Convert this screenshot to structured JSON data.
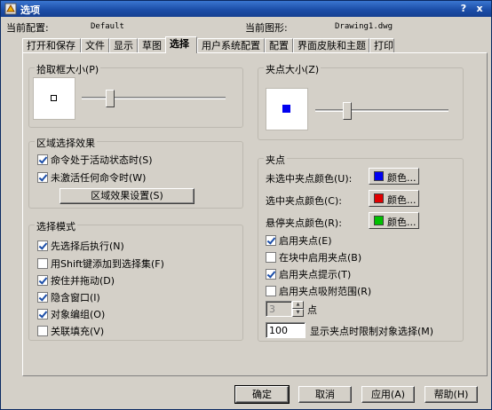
{
  "window": {
    "title": "选项",
    "help": "?",
    "close": "x"
  },
  "info": {
    "config_label": "当前配置:",
    "config_value": "Default",
    "drawing_label": "当前图形:",
    "drawing_value": "Drawing1.dwg"
  },
  "tabs": [
    "打开和保存",
    "文件",
    "显示",
    "草图",
    "选择",
    "用户系统配置",
    "配置",
    "界面皮肤和主题",
    "打印"
  ],
  "active_tab": "选择",
  "pickbox": {
    "title": "拾取框大小(P)",
    "slider_level": 0.18
  },
  "area_effect": {
    "title": "区域选择效果",
    "opt1": "命令处于活动状态时(S)",
    "opt2": "未激活任何命令时(W)",
    "button": "区域效果设置(S)"
  },
  "selection_mode": {
    "title": "选择模式",
    "items": [
      {
        "label": "先选择后执行(N)",
        "checked": true
      },
      {
        "label": "用Shift键添加到选择集(F)",
        "checked": false
      },
      {
        "label": "按住并拖动(D)",
        "checked": true
      },
      {
        "label": "隐含窗口(I)",
        "checked": true
      },
      {
        "label": "对象编组(O)",
        "checked": true
      },
      {
        "label": "关联填充(V)",
        "checked": false
      }
    ]
  },
  "grip_size": {
    "title": "夹点大小(Z)",
    "slider_level": 0.22
  },
  "grips": {
    "title": "夹点",
    "unselected_label": "未选中夹点颜色(U):",
    "selected_label": "选中夹点颜色(C):",
    "hover_label": "悬停夹点颜色(R):",
    "color_button": "颜色...",
    "unselected_color": "#0000f0",
    "selected_color": "#e00000",
    "hover_color": "#00c000",
    "enable_grips": "启用夹点(E)",
    "grips_in_blocks": "在块中启用夹点(B)",
    "grip_tips": "启用夹点提示(T)",
    "grip_snap": "启用夹点吸附范围(R)",
    "points_value": "3",
    "points_label": "点",
    "limit_value": "100",
    "limit_label": "显示夹点时限制对象选择(M)"
  },
  "footer": {
    "ok": "确定",
    "cancel": "取消",
    "apply": "应用(A)",
    "help": "帮助(H)"
  }
}
